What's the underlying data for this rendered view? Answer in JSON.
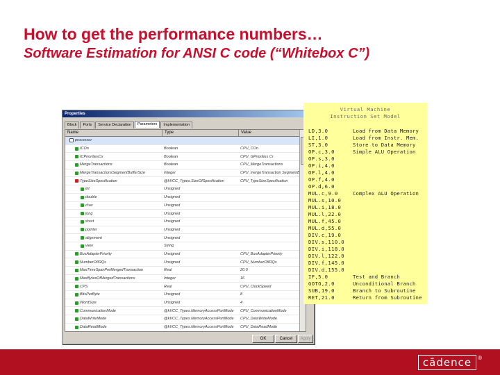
{
  "slide": {
    "title": "How to get the performance numbers…",
    "subtitle": "Software Estimation for ANSI C code (“Whitebox C”)",
    "logo": "cādence",
    "logo_mark": "®",
    "colors": {
      "accent": "#c8102e",
      "footer": "#b01020",
      "note_bg": "#ffff9c"
    }
  },
  "dialog": {
    "title": "Properties",
    "close_glyph": "x",
    "tabs": [
      "Block",
      "Ports",
      "Service Declaration",
      "Parameters",
      "Implementation"
    ],
    "active_tab": 3,
    "columns": [
      "Name",
      "Type",
      "Value"
    ],
    "rows": [
      {
        "name": "processor",
        "type": "",
        "value": "",
        "icon": "box",
        "indent": 0
      },
      {
        "name": "ICOn",
        "type": "Boolean",
        "value": "CPU_COn",
        "icon": "green",
        "indent": 1
      },
      {
        "name": "ICPrioritiesCx",
        "type": "Boolean",
        "value": "CPU_GPriorities Cr",
        "icon": "green",
        "indent": 1
      },
      {
        "name": "MergeTransactions",
        "type": "Boolean",
        "value": "CPU_MergeTransactions",
        "icon": "green",
        "indent": 1
      },
      {
        "name": "MergeTransactionsSegmentBufferSize",
        "type": "Integer",
        "value": "CPU_mergeTransaction SegmentBuff",
        "icon": "green",
        "indent": 1
      },
      {
        "name": "TypeSizeSpecification",
        "type": "@kVCC_Types.SizeOfSpecification",
        "value": "CPU_TypeSizeSpecification",
        "icon": "red",
        "indent": 1
      },
      {
        "name": "int",
        "type": "Unsigned",
        "value": "",
        "icon": "green",
        "indent": 2
      },
      {
        "name": "double",
        "type": "Unsigned",
        "value": "",
        "icon": "green",
        "indent": 2
      },
      {
        "name": "char",
        "type": "Unsigned",
        "value": "",
        "icon": "green",
        "indent": 2
      },
      {
        "name": "long",
        "type": "Unsigned",
        "value": "",
        "icon": "green",
        "indent": 2
      },
      {
        "name": "short",
        "type": "Unsigned",
        "value": "",
        "icon": "green",
        "indent": 2
      },
      {
        "name": "pointer",
        "type": "Unsigned",
        "value": "",
        "icon": "green",
        "indent": 2
      },
      {
        "name": "alignment",
        "type": "Unsigned",
        "value": "",
        "icon": "green",
        "indent": 2
      },
      {
        "name": "view",
        "type": "String",
        "value": "",
        "icon": "green",
        "indent": 2
      },
      {
        "name": "BusAdapterPriority",
        "type": "Unsigned",
        "value": "CPU_BusAdapterPriority",
        "icon": "green",
        "indent": 1
      },
      {
        "name": "NumberOfIRQs",
        "type": "Unsigned",
        "value": "CPU_NumberOfIRQs",
        "icon": "green",
        "indent": 1
      },
      {
        "name": "MaxTimeSpanPerMergedTransaction",
        "type": "Real",
        "value": "20.0",
        "icon": "green",
        "indent": 1
      },
      {
        "name": "MaxBytesOfMergedTransactions",
        "type": "Integer",
        "value": "16",
        "icon": "green",
        "indent": 1
      },
      {
        "name": "CPS",
        "type": "Real",
        "value": "CPU_ClockSpeed",
        "icon": "green",
        "indent": 1
      },
      {
        "name": "BitsPerByte",
        "type": "Unsigned",
        "value": "8",
        "icon": "green",
        "indent": 1
      },
      {
        "name": "WordSize",
        "type": "Unsigned",
        "value": "4",
        "icon": "green",
        "indent": 1
      },
      {
        "name": "CommunicationMode",
        "type": "@kVCC_Types.MemoryAccessPortMode",
        "value": "CPU_CommunicationMode",
        "icon": "green",
        "indent": 1
      },
      {
        "name": "DataWriteMode",
        "type": "@kVCC_Types.MemoryAccessPortMode",
        "value": "CPU_DataWriteMode",
        "icon": "green",
        "indent": 1
      },
      {
        "name": "DataReadMode",
        "type": "@kVCC_Types.MemoryAccessPortMode",
        "value": "CPU_DataReadMode",
        "icon": "green",
        "indent": 1
      },
      {
        "name": "InstructionMode",
        "type": "@kVCC_Types.MemoryAccessPortMode",
        "value": "CPU_InstructionMode",
        "icon": "green",
        "indent": 1
      },
      {
        "name": "CacheSize",
        "type": "Unsigned",
        "value": "1024",
        "icon": "green",
        "indent": 1
      },
      {
        "name": "PROVIDERNAME",
        "type": "STRING",
        "value": "\"Cadence Design Systems, Inc.\"",
        "icon": "green",
        "indent": 1
      },
      {
        "name": "VERSION",
        "type": "STRING",
        "value": "\"1.0\"",
        "icon": "green",
        "indent": 1
      }
    ],
    "buttons": {
      "ok": "OK",
      "cancel": "Cancel",
      "apply": "Apply"
    }
  },
  "vm_note": {
    "heading_line1": "Virtual Machine",
    "heading_line2": "Instruction Set Model",
    "instructions": [
      "LD,3.0",
      "LI,1.0",
      "ST,3.0",
      "OP.c,3.0",
      "OP.s,3.0",
      "OP.i,4.0",
      "OP.l,4.0",
      "OP.f,4.0",
      "OP.d,6.0",
      "MUL.c,9.0",
      "MUL.s,10.0",
      "MUL.i,18.0",
      "MUL.l,22.0",
      "MUL.f,45.0",
      "MUL.d,55.0",
      "DIV.c,19.0",
      "DIV.s,110.0",
      "DIV.i,118.0",
      "DIV.l,122.0",
      "DIV.f,145.0",
      "DIV.d,155.0",
      "IF,5.0",
      "GOTO,2.0",
      "SUB,19.0",
      "RET,21.0"
    ],
    "descriptions": [
      {
        "row": 0,
        "text": "Load from Data Memory"
      },
      {
        "row": 1,
        "text": "Load from Instr. Mem."
      },
      {
        "row": 2,
        "text": "Store to Data Memory"
      },
      {
        "row": 3,
        "text": "Simple ALU Operation"
      },
      {
        "row": 9,
        "text": "Complex ALU Operation"
      },
      {
        "row": 21,
        "text": "Test and Branch"
      },
      {
        "row": 22,
        "text": "Unconditional Branch"
      },
      {
        "row": 23,
        "text": "Branch to Subroutine"
      },
      {
        "row": 24,
        "text": "Return from Subroutine"
      }
    ]
  }
}
